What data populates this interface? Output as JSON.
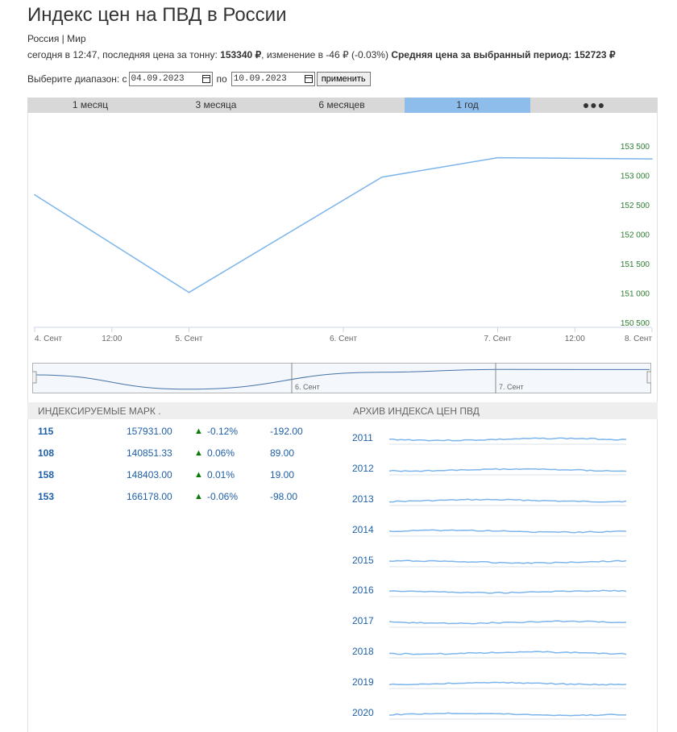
{
  "title": "Индекс цен на ПВД в России",
  "region": "Россия | Мир",
  "status": {
    "prefix": "сегодня в 12:47, последняя цена за тонну:",
    "last_price": "153340 ₽",
    "change": ", изменение в -46 ₽ (-0.03%)",
    "avg_label": "Средняя цена за выбранный период:",
    "avg_value": "152723 ₽"
  },
  "range": {
    "label": "Выберите диапазон: с",
    "from": "04.09.2023",
    "to_label": "по",
    "to": "10.09.2023",
    "apply": "применить"
  },
  "tabs": [
    {
      "label": "1 месяц"
    },
    {
      "label": "3 месяца"
    },
    {
      "label": "6 месяцев"
    },
    {
      "label": "1 год"
    },
    {
      "label": "●●●"
    }
  ],
  "active_tab": 3,
  "colors": {
    "line": "#7cb5ec",
    "active_tab": "#8ebdeb",
    "axis_label": "#2e7d32",
    "link": "#1f5fa6"
  },
  "chart_data": {
    "type": "line",
    "x": [
      "2023-09-04 00:00",
      "2023-09-05 00:00",
      "2023-09-06 06:00",
      "2023-09-07 00:00",
      "2023-09-08 00:00"
    ],
    "values": [
      152670,
      151010,
      152970,
      153300,
      153280
    ],
    "ylim": [
      150500,
      153500
    ],
    "y_ticks": [
      "153 500",
      "153 000",
      "152 500",
      "152 000",
      "151 500",
      "151 000",
      "150 500"
    ],
    "x_ticks": [
      "4. Сент",
      "12:00",
      "5. Сент",
      "6. Сент",
      "7. Сент",
      "12:00",
      "8. Сент"
    ],
    "navigator_labels": [
      "6. Сент",
      "7. Сент"
    ]
  },
  "marks_title": "Индексируемые марк .",
  "marks": [
    {
      "name": "115",
      "price": "157931.00",
      "arrow": "▲",
      "pct": "-0.12%",
      "diff": "-192.00"
    },
    {
      "name": "108",
      "price": "140851.33",
      "arrow": "▲",
      "pct": "0.06%",
      "diff": "89.00"
    },
    {
      "name": "158",
      "price": "148403.00",
      "arrow": "▲",
      "pct": "0.01%",
      "diff": "19.00"
    },
    {
      "name": "153",
      "price": "166178.00",
      "arrow": "▲",
      "pct": "-0.06%",
      "diff": "-98.00"
    }
  ],
  "archive_title": "Архив индекса цен ПВД",
  "archive": [
    {
      "year": "2011"
    },
    {
      "year": "2012"
    },
    {
      "year": "2013"
    },
    {
      "year": "2014"
    },
    {
      "year": "2015"
    },
    {
      "year": "2016"
    },
    {
      "year": "2017"
    },
    {
      "year": "2018"
    },
    {
      "year": "2019"
    },
    {
      "year": "2020"
    }
  ]
}
